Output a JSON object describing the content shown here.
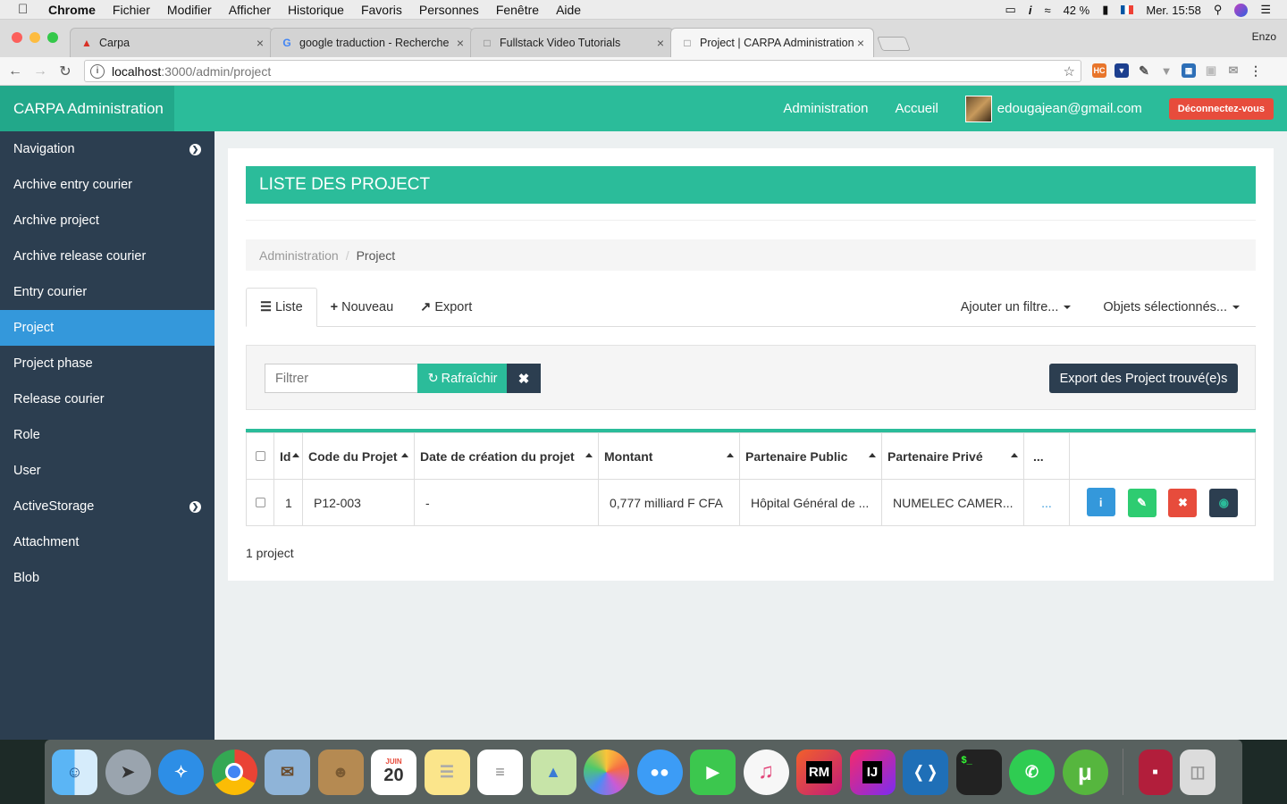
{
  "menubar": {
    "app": "Chrome",
    "menus": [
      "Fichier",
      "Modifier",
      "Afficher",
      "Historique",
      "Favoris",
      "Personnes",
      "Fenêtre",
      "Aide"
    ],
    "battery": "42 %",
    "clock": "Mer. 15:58"
  },
  "browser": {
    "tabs": [
      {
        "title": "Carpa",
        "icon": "warning-icon"
      },
      {
        "title": "google traduction - Recherche",
        "icon": "google-icon"
      },
      {
        "title": "Fullstack Video Tutorials",
        "icon": "page-icon"
      },
      {
        "title": "Project | CARPA Administration",
        "icon": "page-icon"
      }
    ],
    "profile": "Enzo",
    "url_host": "localhost",
    "url_path": ":3000/admin/project"
  },
  "header": {
    "brand": "CARPA Administration",
    "links": [
      "Administration",
      "Accueil"
    ],
    "user": "edougajean@gmail.com",
    "logout": "Déconnectez-vous"
  },
  "sidebar": {
    "items": [
      {
        "label": "Navigation",
        "chevron": true
      },
      {
        "label": "Archive entry courier"
      },
      {
        "label": "Archive project"
      },
      {
        "label": "Archive release courier"
      },
      {
        "label": "Entry courier"
      },
      {
        "label": "Project",
        "active": true
      },
      {
        "label": "Project phase"
      },
      {
        "label": "Release courier"
      },
      {
        "label": "Role"
      },
      {
        "label": "User"
      },
      {
        "label": "ActiveStorage",
        "chevron": true
      },
      {
        "label": "Attachment"
      },
      {
        "label": "Blob"
      }
    ]
  },
  "page": {
    "title": "LISTE DES PROJECT",
    "breadcrumb": [
      "Administration",
      "Project"
    ],
    "tabs": {
      "list": "Liste",
      "new": "Nouveau",
      "export": "Export"
    },
    "filter_menu": "Ajouter un filtre...",
    "selected_menu": "Objets sélectionnés...",
    "filter_placeholder": "Filtrer",
    "refresh": "Rafraîchir",
    "export_found": "Export des Project trouvé(e)s",
    "count": "1 project"
  },
  "table": {
    "headers": [
      "Id",
      "Code du Projet",
      "Date de création du projet",
      "Montant",
      "Partenaire Public",
      "Partenaire Privé",
      "..."
    ],
    "rows": [
      {
        "id": "1",
        "code": "P12-003",
        "date": "-",
        "montant": "0,777 milliard F CFA",
        "public": "Hôpital Général de ...",
        "prive": "NUMELEC CAMER...",
        "more": "..."
      }
    ]
  },
  "colors": {
    "accent": "#2bbc9a",
    "sidebar": "#2c3e50",
    "active": "#3498db",
    "danger": "#e74c3c"
  }
}
